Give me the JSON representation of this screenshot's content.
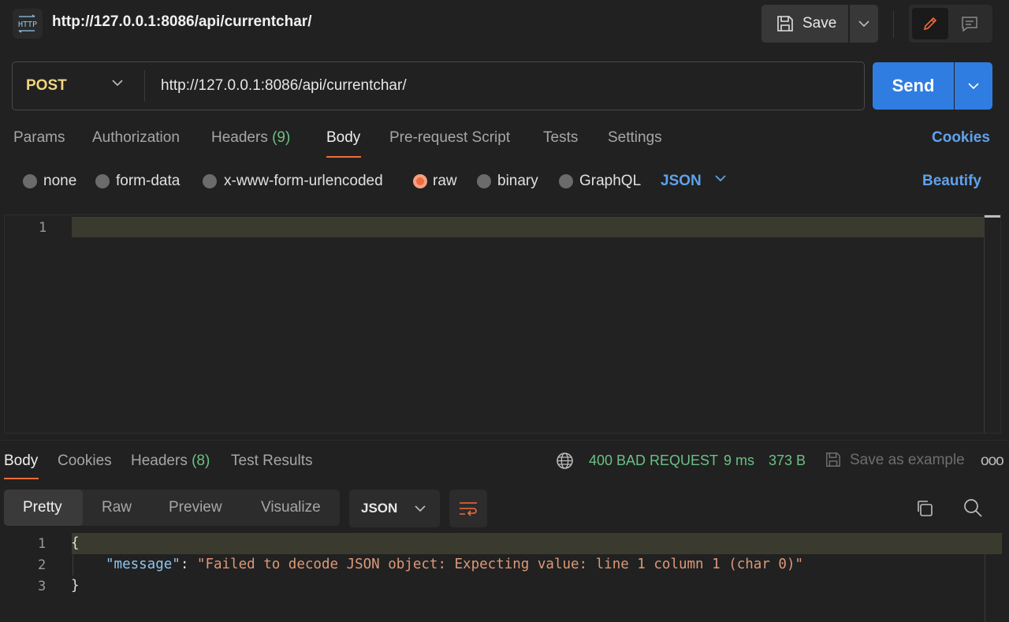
{
  "header": {
    "title": "http://127.0.0.1:8086/api/currentchar/",
    "save_label": "Save"
  },
  "request": {
    "method": "POST",
    "url": "http://127.0.0.1:8086/api/currentchar/",
    "send_label": "Send"
  },
  "request_tabs": {
    "params": "Params",
    "authorization": "Authorization",
    "headers": "Headers",
    "headers_count": "(9)",
    "body": "Body",
    "prerequest": "Pre-request Script",
    "tests": "Tests",
    "settings": "Settings",
    "cookies": "Cookies",
    "active": "Body"
  },
  "body_types": {
    "none": "none",
    "form_data": "form-data",
    "urlencoded": "x-www-form-urlencoded",
    "raw": "raw",
    "binary": "binary",
    "graphql": "GraphQL",
    "selected": "raw",
    "raw_format": "JSON",
    "beautify": "Beautify"
  },
  "request_editor": {
    "lines": [
      "1"
    ]
  },
  "response_tabs": {
    "body": "Body",
    "cookies": "Cookies",
    "headers": "Headers",
    "headers_count": "(8)",
    "test_results": "Test Results",
    "active": "Body"
  },
  "response_status": {
    "status": "400 BAD REQUEST",
    "time": "9 ms",
    "size": "373 B",
    "save_example": "Save as example",
    "more": "ooo"
  },
  "response_view": {
    "pretty": "Pretty",
    "raw": "Raw",
    "preview": "Preview",
    "visualize": "Visualize",
    "active": "Pretty",
    "format": "JSON"
  },
  "response_body": {
    "line_numbers": [
      "1",
      "2",
      "3"
    ],
    "open_brace": "{",
    "key": "\"message\"",
    "colon": ": ",
    "value": "\"Failed to decode JSON object: Expecting value: line 1 column 1 (char 0)\"",
    "close_brace": "}"
  },
  "colors": {
    "accent_orange": "#f26b3a",
    "send_blue": "#2f7de1",
    "link_blue": "#5fa2ec",
    "status_green": "#6cc084",
    "method_yellow": "#f2d57e"
  }
}
